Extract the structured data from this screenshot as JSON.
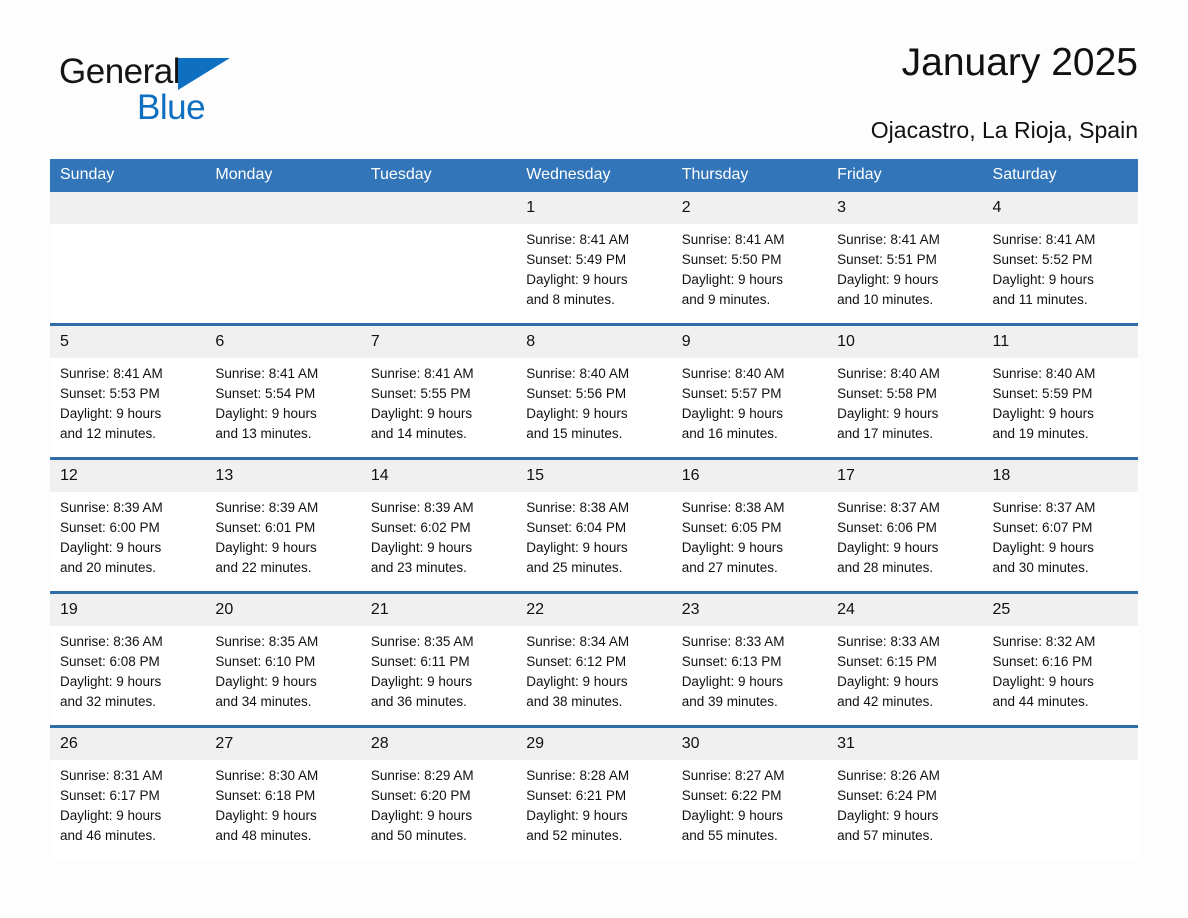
{
  "brand": {
    "name_part1": "General",
    "name_part2": "Blue",
    "logo_icon": "triangle-icon",
    "accent_color": "#0f6fc0",
    "header_color": "#3275b8"
  },
  "header": {
    "title": "January 2025",
    "subtitle": "Ojacastro, La Rioja, Spain"
  },
  "calendar": {
    "weekday_headers": [
      "Sunday",
      "Monday",
      "Tuesday",
      "Wednesday",
      "Thursday",
      "Friday",
      "Saturday"
    ],
    "weeks": [
      [
        {
          "day": "",
          "lines": []
        },
        {
          "day": "",
          "lines": []
        },
        {
          "day": "",
          "lines": []
        },
        {
          "day": "1",
          "lines": [
            "Sunrise: 8:41 AM",
            "Sunset: 5:49 PM",
            "Daylight: 9 hours",
            "and 8 minutes."
          ]
        },
        {
          "day": "2",
          "lines": [
            "Sunrise: 8:41 AM",
            "Sunset: 5:50 PM",
            "Daylight: 9 hours",
            "and 9 minutes."
          ]
        },
        {
          "day": "3",
          "lines": [
            "Sunrise: 8:41 AM",
            "Sunset: 5:51 PM",
            "Daylight: 9 hours",
            "and 10 minutes."
          ]
        },
        {
          "day": "4",
          "lines": [
            "Sunrise: 8:41 AM",
            "Sunset: 5:52 PM",
            "Daylight: 9 hours",
            "and 11 minutes."
          ]
        }
      ],
      [
        {
          "day": "5",
          "lines": [
            "Sunrise: 8:41 AM",
            "Sunset: 5:53 PM",
            "Daylight: 9 hours",
            "and 12 minutes."
          ]
        },
        {
          "day": "6",
          "lines": [
            "Sunrise: 8:41 AM",
            "Sunset: 5:54 PM",
            "Daylight: 9 hours",
            "and 13 minutes."
          ]
        },
        {
          "day": "7",
          "lines": [
            "Sunrise: 8:41 AM",
            "Sunset: 5:55 PM",
            "Daylight: 9 hours",
            "and 14 minutes."
          ]
        },
        {
          "day": "8",
          "lines": [
            "Sunrise: 8:40 AM",
            "Sunset: 5:56 PM",
            "Daylight: 9 hours",
            "and 15 minutes."
          ]
        },
        {
          "day": "9",
          "lines": [
            "Sunrise: 8:40 AM",
            "Sunset: 5:57 PM",
            "Daylight: 9 hours",
            "and 16 minutes."
          ]
        },
        {
          "day": "10",
          "lines": [
            "Sunrise: 8:40 AM",
            "Sunset: 5:58 PM",
            "Daylight: 9 hours",
            "and 17 minutes."
          ]
        },
        {
          "day": "11",
          "lines": [
            "Sunrise: 8:40 AM",
            "Sunset: 5:59 PM",
            "Daylight: 9 hours",
            "and 19 minutes."
          ]
        }
      ],
      [
        {
          "day": "12",
          "lines": [
            "Sunrise: 8:39 AM",
            "Sunset: 6:00 PM",
            "Daylight: 9 hours",
            "and 20 minutes."
          ]
        },
        {
          "day": "13",
          "lines": [
            "Sunrise: 8:39 AM",
            "Sunset: 6:01 PM",
            "Daylight: 9 hours",
            "and 22 minutes."
          ]
        },
        {
          "day": "14",
          "lines": [
            "Sunrise: 8:39 AM",
            "Sunset: 6:02 PM",
            "Daylight: 9 hours",
            "and 23 minutes."
          ]
        },
        {
          "day": "15",
          "lines": [
            "Sunrise: 8:38 AM",
            "Sunset: 6:04 PM",
            "Daylight: 9 hours",
            "and 25 minutes."
          ]
        },
        {
          "day": "16",
          "lines": [
            "Sunrise: 8:38 AM",
            "Sunset: 6:05 PM",
            "Daylight: 9 hours",
            "and 27 minutes."
          ]
        },
        {
          "day": "17",
          "lines": [
            "Sunrise: 8:37 AM",
            "Sunset: 6:06 PM",
            "Daylight: 9 hours",
            "and 28 minutes."
          ]
        },
        {
          "day": "18",
          "lines": [
            "Sunrise: 8:37 AM",
            "Sunset: 6:07 PM",
            "Daylight: 9 hours",
            "and 30 minutes."
          ]
        }
      ],
      [
        {
          "day": "19",
          "lines": [
            "Sunrise: 8:36 AM",
            "Sunset: 6:08 PM",
            "Daylight: 9 hours",
            "and 32 minutes."
          ]
        },
        {
          "day": "20",
          "lines": [
            "Sunrise: 8:35 AM",
            "Sunset: 6:10 PM",
            "Daylight: 9 hours",
            "and 34 minutes."
          ]
        },
        {
          "day": "21",
          "lines": [
            "Sunrise: 8:35 AM",
            "Sunset: 6:11 PM",
            "Daylight: 9 hours",
            "and 36 minutes."
          ]
        },
        {
          "day": "22",
          "lines": [
            "Sunrise: 8:34 AM",
            "Sunset: 6:12 PM",
            "Daylight: 9 hours",
            "and 38 minutes."
          ]
        },
        {
          "day": "23",
          "lines": [
            "Sunrise: 8:33 AM",
            "Sunset: 6:13 PM",
            "Daylight: 9 hours",
            "and 39 minutes."
          ]
        },
        {
          "day": "24",
          "lines": [
            "Sunrise: 8:33 AM",
            "Sunset: 6:15 PM",
            "Daylight: 9 hours",
            "and 42 minutes."
          ]
        },
        {
          "day": "25",
          "lines": [
            "Sunrise: 8:32 AM",
            "Sunset: 6:16 PM",
            "Daylight: 9 hours",
            "and 44 minutes."
          ]
        }
      ],
      [
        {
          "day": "26",
          "lines": [
            "Sunrise: 8:31 AM",
            "Sunset: 6:17 PM",
            "Daylight: 9 hours",
            "and 46 minutes."
          ]
        },
        {
          "day": "27",
          "lines": [
            "Sunrise: 8:30 AM",
            "Sunset: 6:18 PM",
            "Daylight: 9 hours",
            "and 48 minutes."
          ]
        },
        {
          "day": "28",
          "lines": [
            "Sunrise: 8:29 AM",
            "Sunset: 6:20 PM",
            "Daylight: 9 hours",
            "and 50 minutes."
          ]
        },
        {
          "day": "29",
          "lines": [
            "Sunrise: 8:28 AM",
            "Sunset: 6:21 PM",
            "Daylight: 9 hours",
            "and 52 minutes."
          ]
        },
        {
          "day": "30",
          "lines": [
            "Sunrise: 8:27 AM",
            "Sunset: 6:22 PM",
            "Daylight: 9 hours",
            "and 55 minutes."
          ]
        },
        {
          "day": "31",
          "lines": [
            "Sunrise: 8:26 AM",
            "Sunset: 6:24 PM",
            "Daylight: 9 hours",
            "and 57 minutes."
          ]
        },
        {
          "day": "",
          "lines": []
        }
      ]
    ]
  }
}
